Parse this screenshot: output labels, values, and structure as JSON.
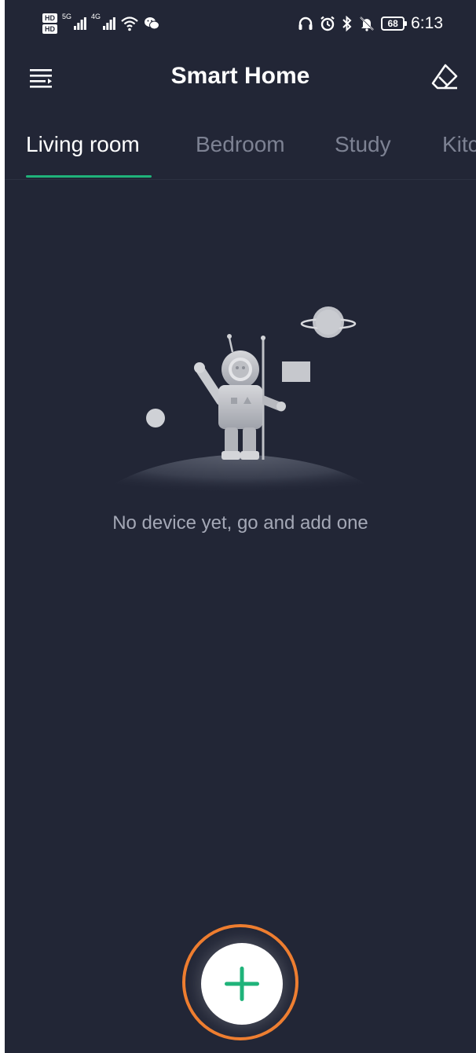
{
  "status_bar": {
    "hd_top": "HD",
    "hd_bottom": "HD",
    "signal_5g": "5G",
    "signal_4g": "4G",
    "battery": "68",
    "time": "6:13"
  },
  "header": {
    "title": "Smart Home"
  },
  "tabs": [
    {
      "label": "Living room"
    },
    {
      "label": "Bedroom"
    },
    {
      "label": "Study"
    },
    {
      "label": "Kitchen"
    }
  ],
  "empty_state": {
    "message": "No device yet, go and add one"
  },
  "colors": {
    "background": "#222636",
    "accent": "#1fb37a",
    "highlight_ring": "#ee7d2f"
  },
  "icons": {
    "menu": "menu-icon",
    "eraser": "eraser-icon",
    "add": "plus-icon"
  }
}
